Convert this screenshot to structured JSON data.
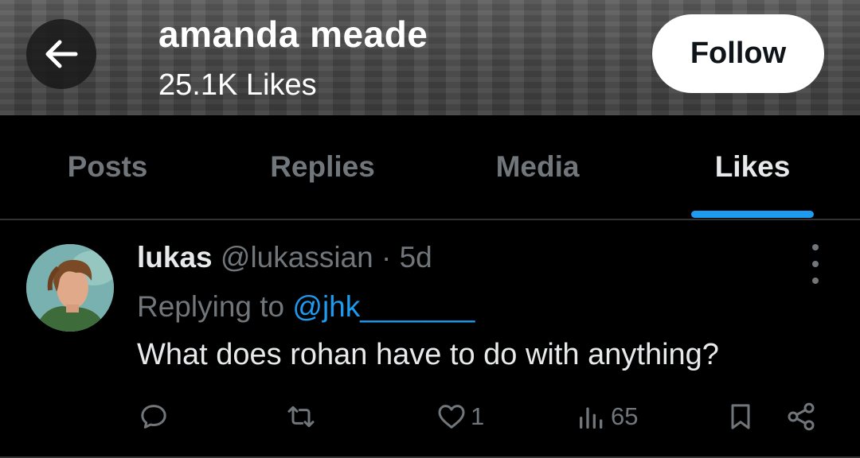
{
  "header": {
    "back_icon": "arrow-left-icon",
    "name": "amanda meade",
    "stat": "25.1K Likes",
    "follow_label": "Follow"
  },
  "tabs": [
    {
      "label": "Posts",
      "active": false
    },
    {
      "label": "Replies",
      "active": false
    },
    {
      "label": "Media",
      "active": false
    },
    {
      "label": "Likes",
      "active": true
    }
  ],
  "post": {
    "author_name": "lukas",
    "author_handle": "@lukassian",
    "separator": "·",
    "time": "5d",
    "reply_prefix": "Replying to",
    "reply_to": "@jhk_______",
    "text": "What does rohan have to do with anything?",
    "actions": {
      "reply": {
        "icon": "reply-icon",
        "count": ""
      },
      "repost": {
        "icon": "repost-icon",
        "count": ""
      },
      "like": {
        "icon": "heart-icon",
        "count": "1"
      },
      "views": {
        "icon": "views-icon",
        "count": "65"
      },
      "bookmark": {
        "icon": "bookmark-icon"
      },
      "share": {
        "icon": "share-icon"
      }
    }
  },
  "colors": {
    "background": "#000000",
    "accent": "#1d9bf0",
    "text_primary": "#e7e9ea",
    "text_secondary": "#71767b",
    "divider": "#2f3336"
  }
}
